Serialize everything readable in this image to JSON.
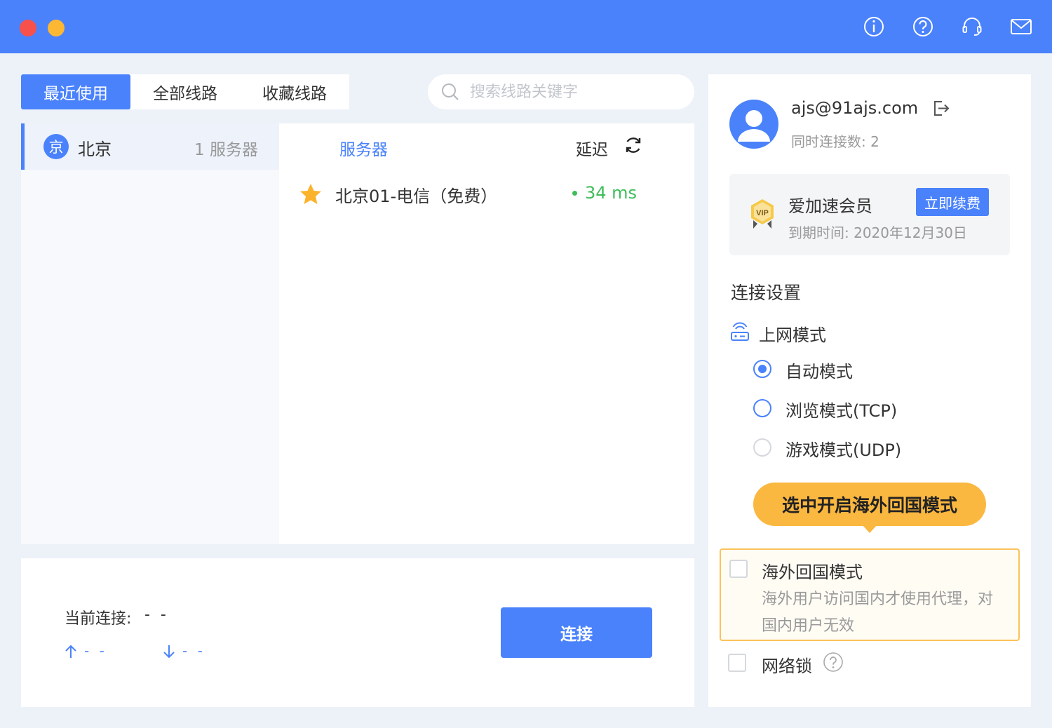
{
  "titlebar": {
    "bg_color": "#4a82fb",
    "icons": [
      "info-icon",
      "help-icon",
      "headset-icon",
      "mail-icon"
    ]
  },
  "tabs": [
    {
      "label": "最近使用",
      "active": true
    },
    {
      "label": "全部线路",
      "active": false
    },
    {
      "label": "收藏线路",
      "active": false
    }
  ],
  "search": {
    "placeholder": "搜索线路关键字"
  },
  "region": {
    "badge": "京",
    "name": "北京",
    "count": "1 服务器"
  },
  "server_header": {
    "server": "服务器",
    "latency": "延迟"
  },
  "servers": [
    {
      "name": "北京01-电信（免费）",
      "latency": "34 ms",
      "favorite": true
    }
  ],
  "connection": {
    "label": "当前连接:",
    "value": "- -",
    "upload": "- -",
    "download": "- -",
    "button": "连接"
  },
  "account": {
    "email": "ajs@91ajs.com",
    "concurrent": "同时连接数: 2"
  },
  "vip": {
    "title": "爱加速会员",
    "renew": "立即续费",
    "expiry": "到期时间: 2020年12月30日"
  },
  "settings": {
    "title": "连接设置",
    "mode_title": "上网模式",
    "modes": [
      {
        "label": "自动模式",
        "checked": true
      },
      {
        "label": "浏览模式(TCP)",
        "checked": false
      },
      {
        "label": "游戏模式(UDP)",
        "checked": false
      }
    ],
    "tooltip": "选中开启海外回国模式",
    "overseas": {
      "title": "海外回国模式",
      "desc": "海外用户访问国内才使用代理，对国内用户无效"
    },
    "netlock": "网络锁"
  }
}
